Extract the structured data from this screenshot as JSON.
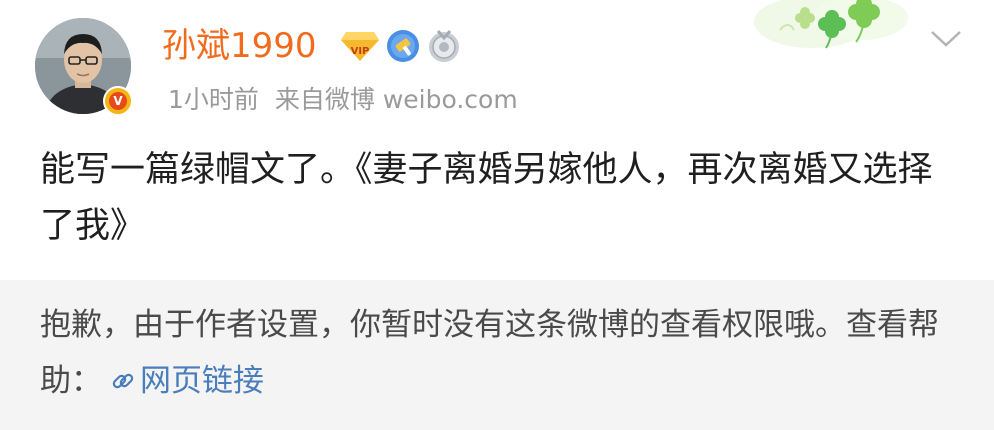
{
  "post": {
    "author": {
      "name": "孙斌1990",
      "badges": [
        "vip-diamond-badge",
        "blue-shield-badge",
        "silver-medal-badge"
      ],
      "verified_mark": "V"
    },
    "meta": {
      "time": "1小时前",
      "source": "来自微博 weibo.com"
    },
    "content": "能写一篇绿帽文了。《妻子离婚另嫁他人，再次离婚又选择了我》"
  },
  "notice": {
    "message": "抱歉，由于作者设置，你暂时没有这条微博的查看权限哦。查看帮助：",
    "link_label": "网页链接",
    "link_icon": "link-icon"
  },
  "colors": {
    "username": "#f26b1c",
    "meta_text": "#9a9a9a",
    "body_text": "#1f1f1f",
    "notice_bg": "#f4f4f4",
    "link": "#4a7dbb",
    "verified_badge": "#f6b516"
  }
}
